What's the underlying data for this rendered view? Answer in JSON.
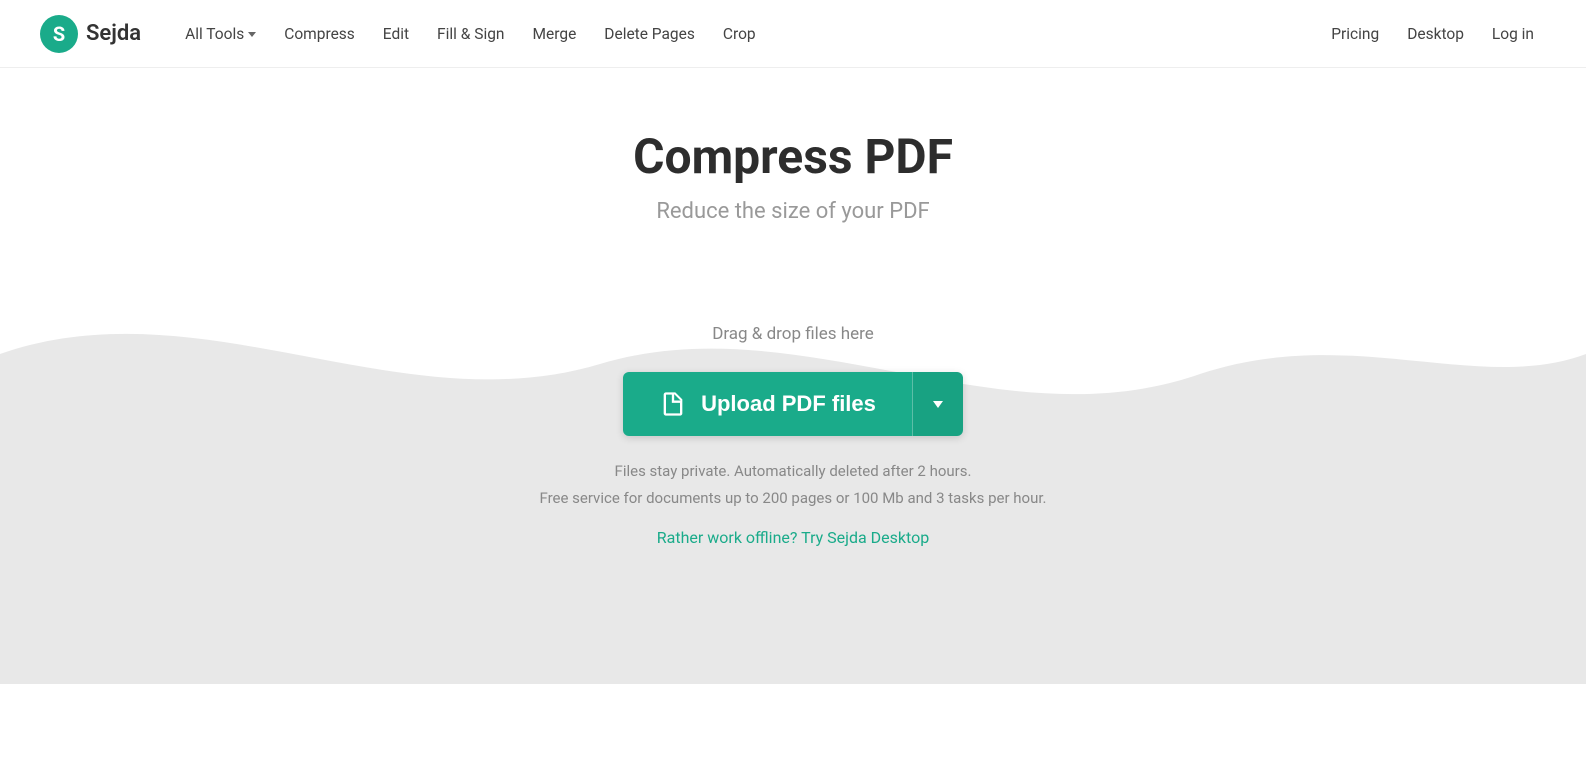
{
  "header": {
    "logo_letter": "S",
    "logo_name": "Sejda",
    "nav_items": [
      {
        "label": "All Tools",
        "has_dropdown": true
      },
      {
        "label": "Compress"
      },
      {
        "label": "Edit"
      },
      {
        "label": "Fill & Sign"
      },
      {
        "label": "Merge"
      },
      {
        "label": "Delete Pages"
      },
      {
        "label": "Crop"
      }
    ],
    "right_nav": [
      {
        "label": "Pricing"
      },
      {
        "label": "Desktop"
      },
      {
        "label": "Log in"
      }
    ]
  },
  "hero": {
    "title": "Compress PDF",
    "subtitle": "Reduce the size of your PDF"
  },
  "upload": {
    "drag_drop_text": "Drag & drop files here",
    "button_label": "Upload PDF files",
    "dropdown_label": "▾",
    "privacy_line1": "Files stay private. Automatically deleted after 2 hours.",
    "privacy_line2": "Free service for documents up to 200 pages or 100 Mb and 3 tasks per hour.",
    "offline_link": "Rather work offline? Try Sejda Desktop"
  }
}
